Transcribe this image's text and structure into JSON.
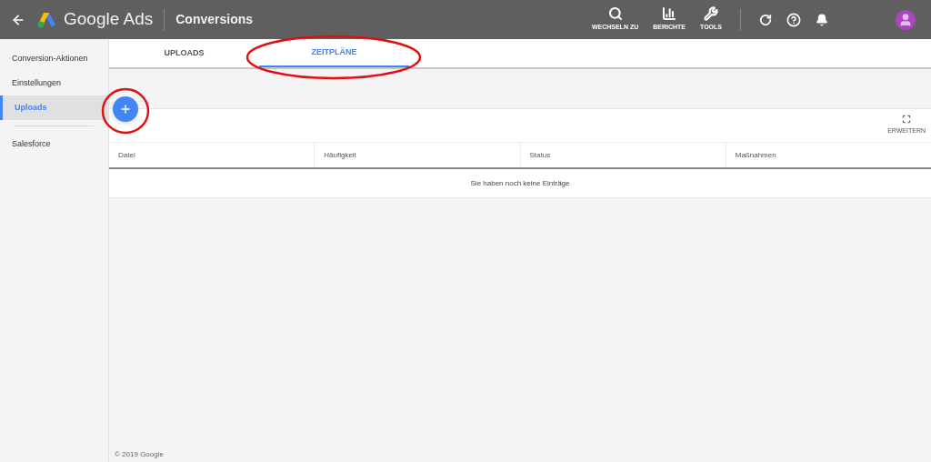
{
  "header": {
    "product": "Google Ads",
    "page_title": "Conversions",
    "tools": [
      {
        "kind": "search",
        "label": "WECHSELN ZU"
      },
      {
        "kind": "reports",
        "label": "BERICHTE"
      },
      {
        "kind": "tools",
        "label": "TOOLS"
      }
    ]
  },
  "sidebar": {
    "items": [
      {
        "label": "Conversion-Aktionen",
        "selected": false
      },
      {
        "label": "Einstellungen",
        "selected": false
      },
      {
        "label": "Uploads",
        "selected": true
      },
      {
        "label": "Salesforce",
        "selected": false,
        "divider_before": true
      }
    ]
  },
  "tabs": [
    {
      "label": "UPLOADS",
      "selected": false
    },
    {
      "label": "ZEITPLÄNE",
      "selected": true
    }
  ],
  "table": {
    "expand_label": "ERWEITERN",
    "columns": [
      "Datei",
      "Häufigkeit",
      "Status",
      "Maßnahmen"
    ],
    "empty_message": "Sie haben noch keine Einträge"
  },
  "footer": "© 2019 Google"
}
